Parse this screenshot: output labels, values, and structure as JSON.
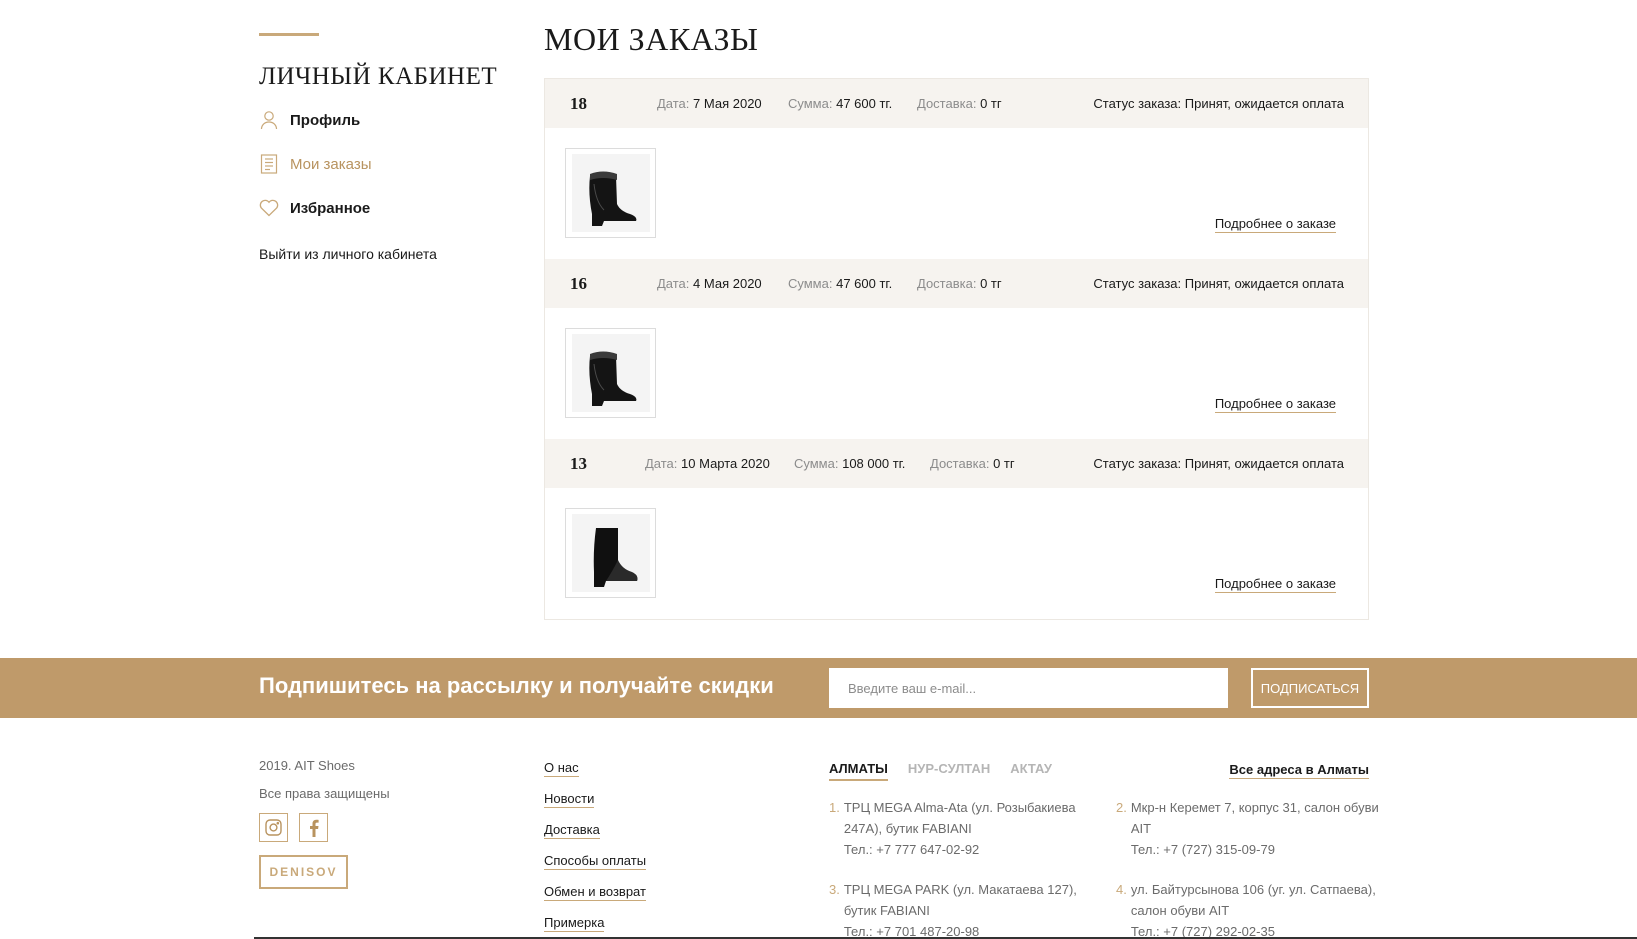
{
  "sidebar": {
    "title": "ЛИЧНЫЙ КАБИНЕТ",
    "items": [
      {
        "label": "Профиль",
        "icon": "user-icon"
      },
      {
        "label": "Мои заказы",
        "icon": "receipt-icon"
      },
      {
        "label": "Избранное",
        "icon": "heart-icon"
      }
    ],
    "logout": "Выйти из личного кабинета"
  },
  "main": {
    "title": "МОИ ЗАКАЗЫ",
    "orders": [
      {
        "number": "18",
        "date_label": "Дата:",
        "date": "7 Мая 2020",
        "sum_label": "Сумма:",
        "sum": "47 600 тг.",
        "delivery_label": "Доставка:",
        "delivery": "0 тг",
        "status": "Статус заказа: Принят, ожидается оплата",
        "more": "Подробнее о заказе",
        "product_image": "fur-lined-black-ankle-boot"
      },
      {
        "number": "16",
        "date_label": "Дата:",
        "date": "4 Мая 2020",
        "sum_label": "Сумма:",
        "sum": "47 600 тг.",
        "delivery_label": "Доставка:",
        "delivery": "0 тг",
        "status": "Статус заказа: Принят, ожидается оплата",
        "more": "Подробнее о заказе",
        "product_image": "fur-lined-black-ankle-boot"
      },
      {
        "number": "13",
        "date_label": "Дата:",
        "date": "10 Марта 2020",
        "sum_label": "Сумма:",
        "sum": "108 000 тг.",
        "delivery_label": "Доставка:",
        "delivery": "0 тг",
        "status": "Статус заказа: Принят, ожидается оплата",
        "more": "Подробнее о заказе",
        "product_image": "black-suede-ankle-boot"
      }
    ]
  },
  "subscribe": {
    "title": "Подпишитесь на рассылку и получайте скидки",
    "placeholder": "Введите ваш e-mail...",
    "button": "ПОДПИСАТЬСЯ"
  },
  "footer": {
    "copyright": "2019. AIT Shoes",
    "rights": "Все права защищены",
    "developer_logo": "DENISOV",
    "links": [
      "О нас",
      "Новости",
      "Доставка",
      "Способы оплаты",
      "Обмен и возврат",
      "Примерка"
    ],
    "city_tabs": [
      "АЛМАТЫ",
      "НУР-СУЛТАН",
      "АКТАУ"
    ],
    "all_addresses": "Все адреса в Алматы",
    "addresses": [
      {
        "n": "1.",
        "text": "ТРЦ MEGA Alma-Ata (ул. Розыбакиева 247А), бутик FABIANI",
        "phone": "Тел.: +7 777 647-02-92"
      },
      {
        "n": "2.",
        "text": "Мкр-н Керемет 7, корпус 31, салон обуви AIT",
        "phone": "Тел.: +7 (727) 315-09-79"
      },
      {
        "n": "3.",
        "text": "ТРЦ MEGA PARK (ул. Макатаева 127), бутик FABIANI",
        "phone": "Тел.: +7 701 487-20-98"
      },
      {
        "n": "4.",
        "text": "ул. Байтурсынова 106 (уг. ул. Сатпаева), салон обуви AIT",
        "phone": "Тел.: +7 (727) 292-02-35"
      }
    ]
  },
  "colors": {
    "accent": "#bf9a6a",
    "header_bg": "#f6f3ef",
    "text": "#1a1a1a",
    "muted": "#8c8c8c"
  }
}
